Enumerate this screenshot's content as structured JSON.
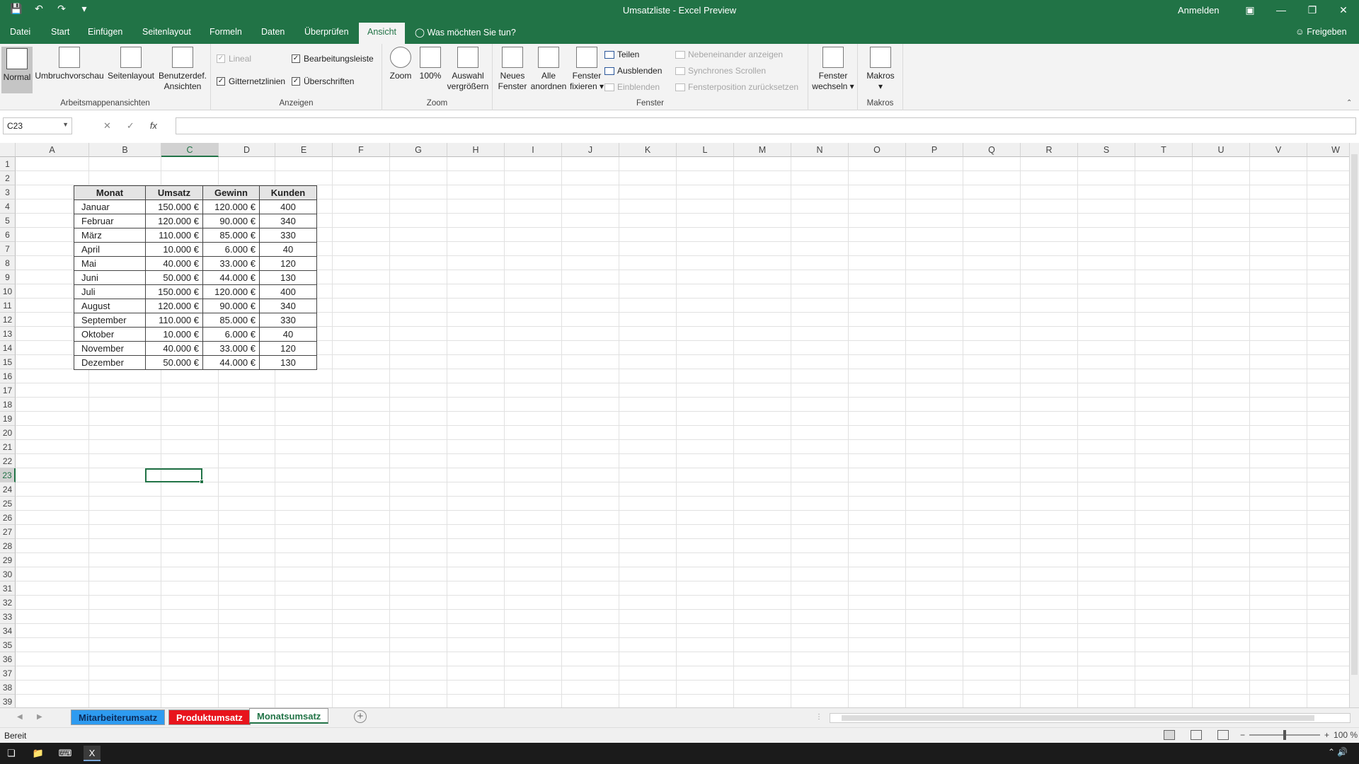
{
  "window": {
    "title": "Umsatzliste - Excel Preview",
    "signin": "Anmelden",
    "save_icon": "save-icon",
    "undo_icon": "undo-icon",
    "redo_icon": "redo-icon"
  },
  "ribbon_tabs": [
    "Datei",
    "Start",
    "Einfügen",
    "Seitenlayout",
    "Formeln",
    "Daten",
    "Überprüfen",
    "Ansicht"
  ],
  "active_tab": "Ansicht",
  "tellme": "Was möchten Sie tun?",
  "share": "Freigeben",
  "groups": {
    "views": {
      "label": "Arbeitsmappenansichten",
      "normal": "Normal",
      "pagebreak": "Umbruchvorschau",
      "pagelayout": "Seitenlayout",
      "custom_line1": "Benutzerdef.",
      "custom_line2": "Ansichten"
    },
    "show": {
      "label": "Anzeigen",
      "ruler": "Lineal",
      "gridlines": "Gitternetzlinien",
      "formulabar": "Bearbeitungsleiste",
      "headings": "Überschriften",
      "check": "✓"
    },
    "zoom": {
      "label": "Zoom",
      "zoom": "Zoom",
      "hundred": "100%",
      "sel_line1": "Auswahl",
      "sel_line2": "vergrößern"
    },
    "window": {
      "label": "Fenster",
      "new_line1": "Neues",
      "new_line2": "Fenster",
      "arrange_line1": "Alle",
      "arrange_line2": "anordnen",
      "freeze_line1": "Fenster",
      "freeze_line2": "fixieren ▾",
      "split": "Teilen",
      "hide": "Ausblenden",
      "unhide": "Einblenden",
      "side": "Nebeneinander anzeigen",
      "sync": "Synchrones Scrollen",
      "reset": "Fensterposition zurücksetzen",
      "switch_line1": "Fenster",
      "switch_line2": "wechseln ▾"
    },
    "macros": {
      "label": "Makros",
      "macros": "Makros",
      "arrow": "▾"
    }
  },
  "formula_bar": {
    "namebox": "C23",
    "cancel": "✕",
    "enter": "✓",
    "fx": "fx",
    "value": ""
  },
  "columns": [
    "A",
    "B",
    "C",
    "D",
    "E",
    "F",
    "G",
    "H",
    "I",
    "J",
    "K",
    "L",
    "M",
    "N",
    "O",
    "P",
    "Q",
    "R",
    "S",
    "T",
    "U",
    "V",
    "W"
  ],
  "rows": [
    "1",
    "2",
    "3",
    "4",
    "5",
    "6",
    "7",
    "8",
    "9",
    "10",
    "11",
    "12",
    "13",
    "14",
    "15",
    "16",
    "17",
    "18",
    "19",
    "20",
    "21",
    "22",
    "23",
    "24",
    "25",
    "26",
    "27",
    "28",
    "29",
    "30",
    "31",
    "32",
    "33",
    "34",
    "35",
    "36",
    "37",
    "38",
    "39"
  ],
  "table": {
    "headers": [
      "Monat",
      "Umsatz",
      "Gewinn",
      "Kunden"
    ],
    "rows": [
      [
        "Januar",
        "150.000 €",
        "120.000 €",
        "400"
      ],
      [
        "Februar",
        "120.000 €",
        "90.000 €",
        "340"
      ],
      [
        "März",
        "110.000 €",
        "85.000 €",
        "330"
      ],
      [
        "April",
        "10.000 €",
        "6.000 €",
        "40"
      ],
      [
        "Mai",
        "40.000 €",
        "33.000 €",
        "120"
      ],
      [
        "Juni",
        "50.000 €",
        "44.000 €",
        "130"
      ],
      [
        "Juli",
        "150.000 €",
        "120.000 €",
        "400"
      ],
      [
        "August",
        "120.000 €",
        "90.000 €",
        "340"
      ],
      [
        "September",
        "110.000 €",
        "85.000 €",
        "330"
      ],
      [
        "Oktober",
        "10.000 €",
        "6.000 €",
        "40"
      ],
      [
        "November",
        "40.000 €",
        "33.000 €",
        "120"
      ],
      [
        "Dezember",
        "50.000 €",
        "44.000 €",
        "130"
      ]
    ]
  },
  "selected_cell": {
    "col": "C",
    "row": "23"
  },
  "sheets": [
    {
      "name": "Mitarbeiterumsatz",
      "bg": "#2e9bf0",
      "fg": "#0b2c5c"
    },
    {
      "name": "Produktumsatz",
      "bg": "#e8141c",
      "fg": "#ffffff"
    },
    {
      "name": "Monatsumsatz",
      "bg": "#ffffff",
      "fg": "#217346",
      "active": true
    }
  ],
  "add_sheet": "+",
  "status": {
    "text": "Bereit",
    "zoom": "100 %",
    "minus": "−",
    "plus": "+"
  }
}
